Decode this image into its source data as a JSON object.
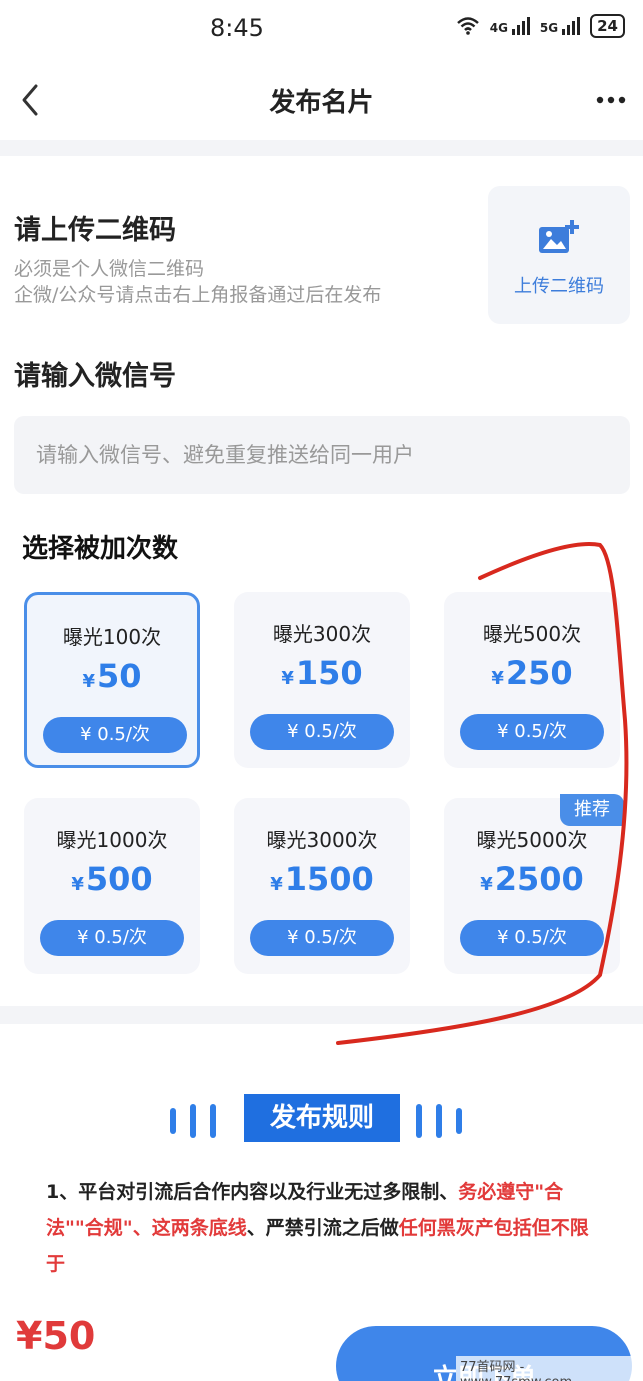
{
  "status_bar": {
    "time": "8:45",
    "network1": "4G",
    "network2": "5G",
    "battery": "24"
  },
  "nav": {
    "title": "发布名片"
  },
  "qr": {
    "title": "请上传二维码",
    "hint1": "必须是个人微信二维码",
    "hint2": "企微/公众号请点击右上角报备通过后在发布",
    "upload_label": "上传二维码"
  },
  "wechat": {
    "title": "请输入微信号",
    "placeholder": "请输入微信号、避免重复推送给同一用户",
    "value": ""
  },
  "packages": {
    "title": "选择被加次数",
    "items": [
      {
        "name": "曝光100次",
        "currency": "¥",
        "price": "50",
        "unit": "¥ 0.5/次",
        "badge": ""
      },
      {
        "name": "曝光300次",
        "currency": "¥",
        "price": "150",
        "unit": "¥ 0.5/次",
        "badge": ""
      },
      {
        "name": "曝光500次",
        "currency": "¥",
        "price": "250",
        "unit": "¥ 0.5/次",
        "badge": ""
      },
      {
        "name": "曝光1000次",
        "currency": "¥",
        "price": "500",
        "unit": "¥ 0.5/次",
        "badge": ""
      },
      {
        "name": "曝光3000次",
        "currency": "¥",
        "price": "1500",
        "unit": "¥ 0.5/次",
        "badge": ""
      },
      {
        "name": "曝光5000次",
        "currency": "¥",
        "price": "2500",
        "unit": "¥ 0.5/次",
        "badge": "推荐"
      }
    ],
    "selected_index": 0
  },
  "rules": {
    "title": "发布规则",
    "text_part1": "1、平台对引流后合作内容以及行业无过多限制、",
    "text_part2": "务必遵守\"合法\"\"合规\"、这两条底线",
    "text_part3": "、严禁引流之后做",
    "text_part4": "任何黑灰产包括但不限于"
  },
  "footer": {
    "total": "¥50",
    "order_label": "立即下单"
  },
  "watermark": "77首码网 - www.77smw.com",
  "colors": {
    "accent": "#3f86ea",
    "price_red": "#e03a3a",
    "annotation": "#d8291e"
  },
  "icons": [
    "back-icon",
    "more-icon",
    "image-add-icon",
    "wifi-icon",
    "signal-icon",
    "battery-icon"
  ]
}
